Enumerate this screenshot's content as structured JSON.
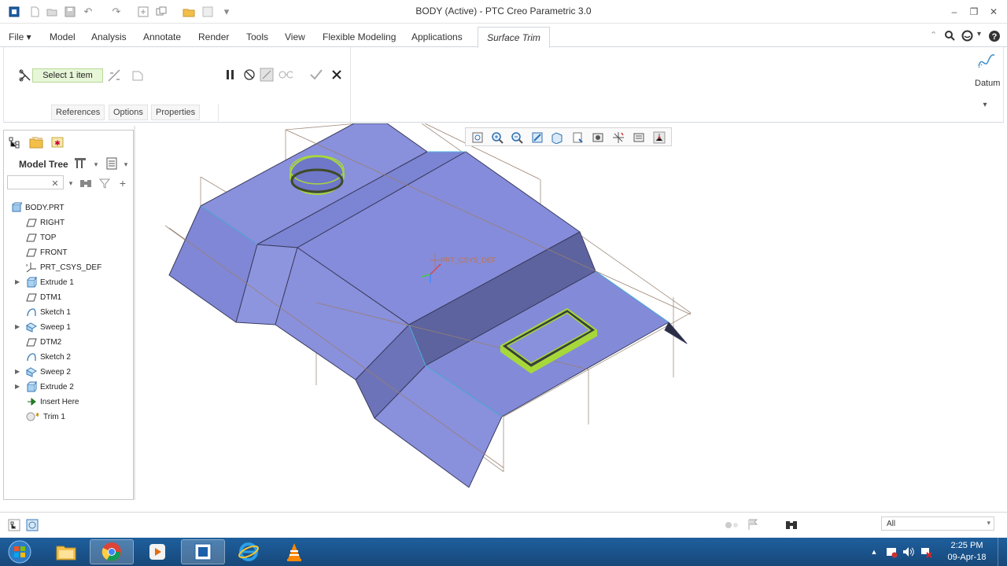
{
  "window": {
    "title": "BODY (Active) - PTC Creo Parametric 3.0"
  },
  "menu": {
    "tabs": [
      "File",
      "Model",
      "Analysis",
      "Annotate",
      "Render",
      "Tools",
      "View",
      "Flexible Modeling",
      "Applications"
    ],
    "active_tab": "Surface Trim"
  },
  "ribbon": {
    "collector_value": "Select 1 item",
    "tabs": [
      "References",
      "Options",
      "Properties"
    ],
    "datum_label": "Datum"
  },
  "model_tree": {
    "title": "Model Tree",
    "items": [
      {
        "label": "BODY.PRT",
        "icon": "part-icon",
        "expandable": false
      },
      {
        "label": "RIGHT",
        "icon": "datum-plane-icon",
        "expandable": false
      },
      {
        "label": "TOP",
        "icon": "datum-plane-icon",
        "expandable": false
      },
      {
        "label": "FRONT",
        "icon": "datum-plane-icon",
        "expandable": false
      },
      {
        "label": "PRT_CSYS_DEF",
        "icon": "csys-icon",
        "expandable": false
      },
      {
        "label": "Extrude 1",
        "icon": "extrude-icon",
        "expandable": true
      },
      {
        "label": "DTM1",
        "icon": "datum-plane-icon",
        "expandable": false
      },
      {
        "label": "Sketch 1",
        "icon": "sketch-icon",
        "expandable": false
      },
      {
        "label": "Sweep 1",
        "icon": "sweep-icon",
        "expandable": true
      },
      {
        "label": "DTM2",
        "icon": "datum-plane-icon",
        "expandable": false
      },
      {
        "label": "Sketch 2",
        "icon": "sketch-icon",
        "expandable": false
      },
      {
        "label": "Sweep 2",
        "icon": "sweep-icon",
        "expandable": true
      },
      {
        "label": "Extrude 2",
        "icon": "extrude-icon",
        "expandable": true
      },
      {
        "label": "Insert Here",
        "icon": "insert-here-icon",
        "expandable": false
      },
      {
        "label": "Trim 1",
        "icon": "trim-icon",
        "expandable": false
      }
    ]
  },
  "graphics": {
    "csys_label": "PRT_CSYS_DEF",
    "surface_color": "#8b92dd",
    "highlight_color": "#a7d83a"
  },
  "statusbar": {
    "filter_value": "All"
  },
  "taskbar": {
    "time": "2:25 PM",
    "date": "09-Apr-18"
  }
}
